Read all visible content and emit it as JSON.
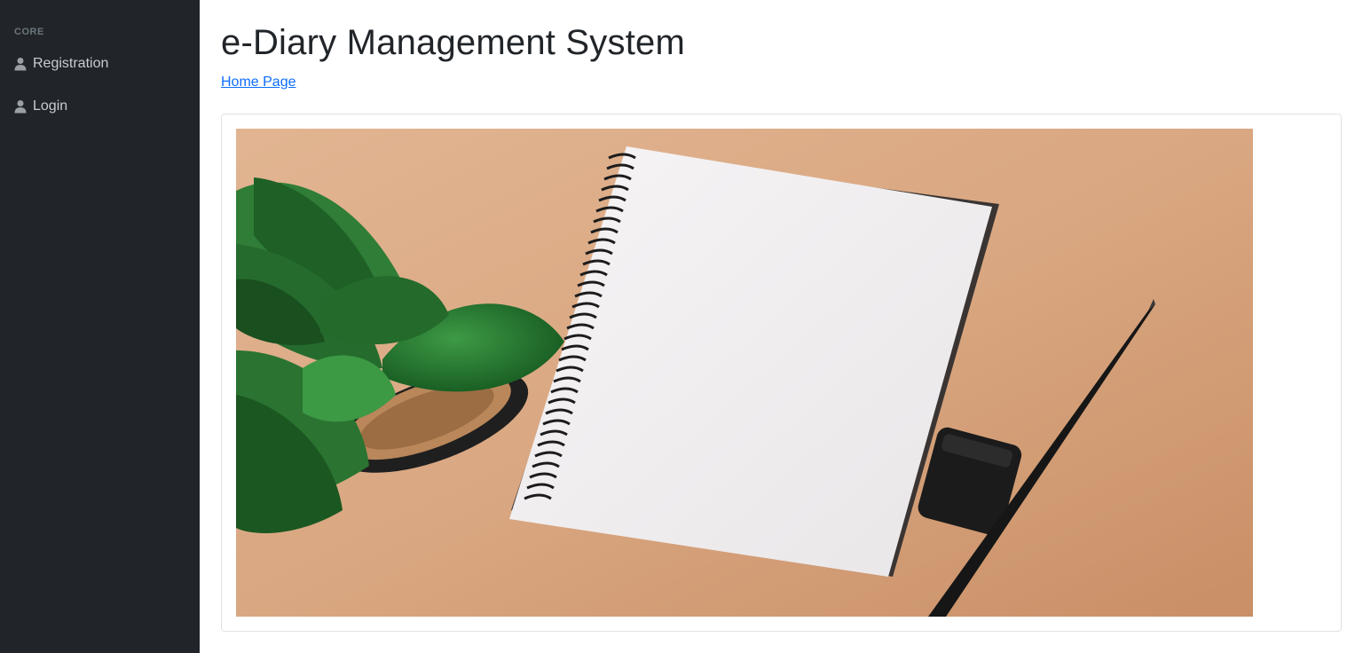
{
  "sidebar": {
    "heading": "CORE",
    "items": [
      {
        "label": "Registration",
        "icon": "user-icon"
      },
      {
        "label": "Login",
        "icon": "user-icon"
      }
    ]
  },
  "header": {
    "title": "e-Diary Management System",
    "breadcrumb": "Home Page"
  },
  "colors": {
    "sidebar_bg": "#212529",
    "link": "#0d6efd",
    "desk": "#d7a47f"
  },
  "hero": {
    "description_icons": [
      "plant",
      "spiral-notebook",
      "eraser",
      "pencil"
    ]
  }
}
